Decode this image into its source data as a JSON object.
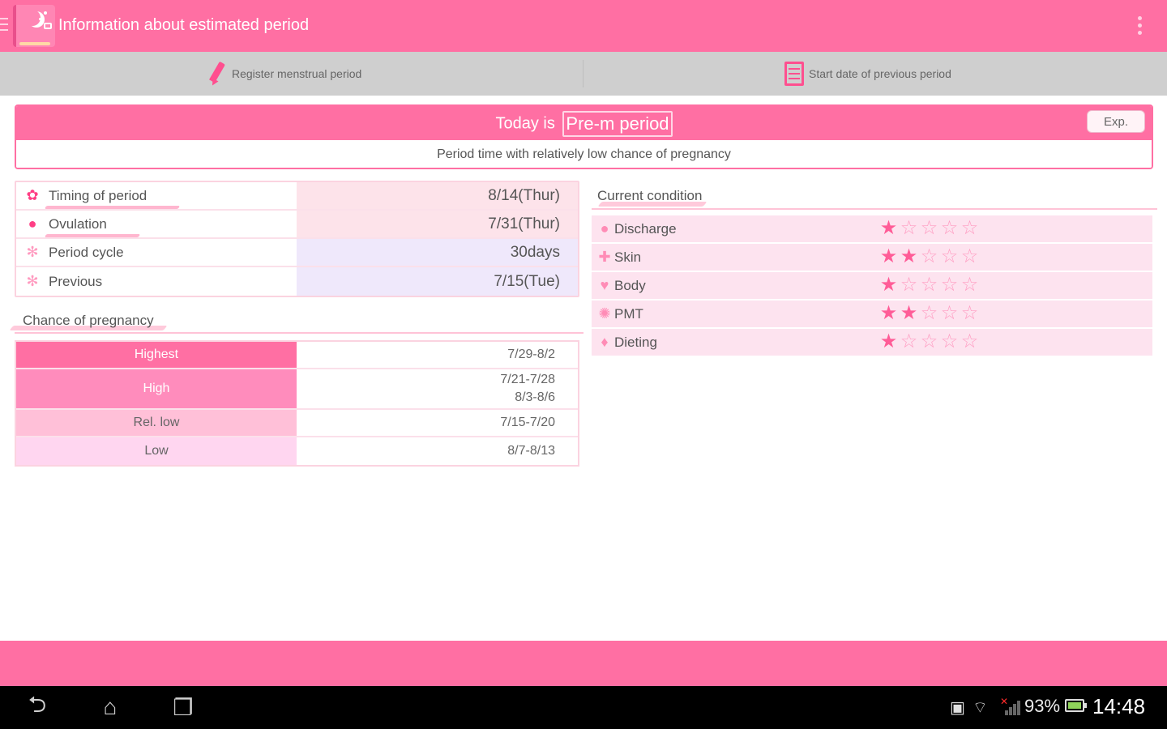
{
  "header": {
    "title": "Information about estimated period",
    "menu_icon": "overflow-menu-icon",
    "app_icon": "moon-app-icon"
  },
  "actions": {
    "register_label": "Register menstrual period",
    "previous_label": "Start date of previous period"
  },
  "status": {
    "today_prefix": "Today is",
    "today_value": "Pre-m period",
    "exp_label": "Exp.",
    "description": "Period time with relatively low chance of pregnancy"
  },
  "info": {
    "rows": [
      {
        "label": "Timing of period",
        "value": "8/14(Thur)",
        "icon": "flower-icon"
      },
      {
        "label": "Ovulation",
        "value": "7/31(Thur)",
        "icon": "duck-icon"
      },
      {
        "label": "Period cycle",
        "value": "30days",
        "icon": "asterisk-icon"
      },
      {
        "label": "Previous",
        "value": "7/15(Tue)",
        "icon": "asterisk-icon"
      }
    ]
  },
  "pregnancy": {
    "title": "Chance of pregnancy",
    "rows": [
      {
        "level": "Highest",
        "dates": [
          "7/29-8/2"
        ],
        "color": "#ff6fa3"
      },
      {
        "level": "High",
        "dates": [
          "7/21-7/28",
          "8/3-8/6"
        ],
        "color": "#ff8cbc"
      },
      {
        "level": "Rel. low",
        "dates": [
          "7/15-7/20"
        ],
        "color": "#ffc0d8"
      },
      {
        "level": "Low",
        "dates": [
          "8/7-8/13"
        ],
        "color": "#ffd6f0"
      }
    ]
  },
  "condition": {
    "title": "Current condition",
    "rows": [
      {
        "name": "Discharge",
        "stars": 1,
        "max": 5,
        "icon": "drop-icon"
      },
      {
        "name": "Skin",
        "stars": 2,
        "max": 5,
        "icon": "cross-icon"
      },
      {
        "name": "Body",
        "stars": 1,
        "max": 5,
        "icon": "heart-icon"
      },
      {
        "name": "PMT",
        "stars": 2,
        "max": 5,
        "icon": "flower-icon"
      },
      {
        "name": "Dieting",
        "stars": 1,
        "max": 5,
        "icon": "diamond-icon"
      }
    ]
  },
  "system": {
    "battery": "93%",
    "time": "14:48"
  },
  "colors": {
    "accent": "#ff6fa3",
    "star_on": "#ff5c97"
  }
}
